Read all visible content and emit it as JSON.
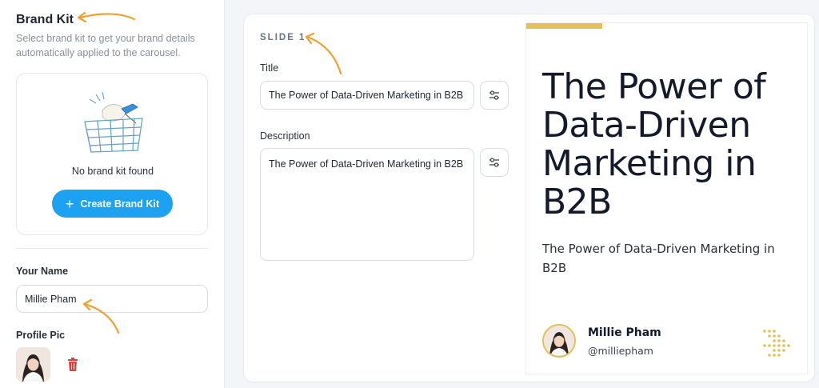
{
  "sidebar": {
    "brand_kit": {
      "title": "Brand Kit",
      "description": "Select brand kit to get your brand details automatically applied to the carousel.",
      "empty_text": "No brand kit found",
      "create_button_label": "Create Brand Kit"
    },
    "your_name": {
      "label": "Your Name",
      "value": "Millie Pham"
    },
    "profile_pic": {
      "label": "Profile Pic"
    }
  },
  "editor": {
    "slide_label": "SLIDE 1",
    "title_label": "Title",
    "title_value": "The Power of Data-Driven Marketing in B2B",
    "description_label": "Description",
    "description_value": "The Power of Data-Driven Marketing in B2B"
  },
  "preview": {
    "title": "The Power of Data-Driven Marketing in B2B",
    "description": "The Power of Data-Driven Marketing in B2B",
    "author_name": "Millie Pham",
    "author_handle": "@milliepham"
  },
  "colors": {
    "accent_yellow": "#e2c255",
    "primary_blue": "#1da1f2",
    "annotation_orange": "#f0a030",
    "delete_red": "#d9433a"
  },
  "icons": {
    "settings": "sliders-icon",
    "delete": "trash-icon",
    "add": "plus-icon",
    "arrow": "dotted-arrow-icon"
  }
}
